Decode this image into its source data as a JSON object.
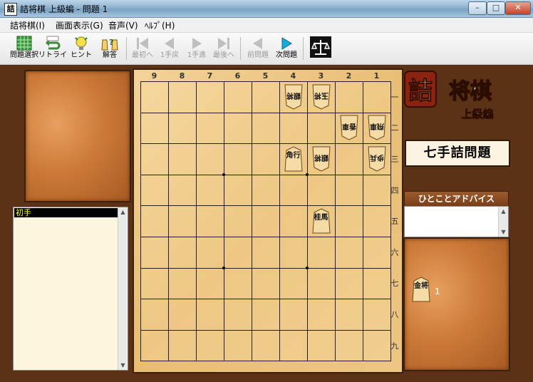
{
  "window": {
    "app_icon": "詰",
    "title": "詰将棋 上級編 - 問題 1",
    "buttons": {
      "minimize": "–",
      "maximize": "□",
      "close": "✕"
    }
  },
  "menu": [
    {
      "label": "詰将棋(I)"
    },
    {
      "label": "画面表示(G)"
    },
    {
      "label": "音声(V)"
    },
    {
      "label": "ﾍﾙﾌﾟ(H)"
    }
  ],
  "toolbar": [
    {
      "label": "問題選択",
      "icon": "grid-icon",
      "enabled": true
    },
    {
      "label": "リトライ",
      "icon": "retry-icon",
      "enabled": true
    },
    {
      "label": "ヒント",
      "icon": "hint-icon",
      "enabled": true
    },
    {
      "label": "解答",
      "icon": "answer-icon",
      "enabled": true
    },
    {
      "label": "最初へ",
      "icon": "first-icon",
      "enabled": false
    },
    {
      "label": "1手戻",
      "icon": "back-icon",
      "enabled": false
    },
    {
      "label": "1手進",
      "icon": "forward-icon",
      "enabled": false
    },
    {
      "label": "最後へ",
      "icon": "last-icon",
      "enabled": false
    },
    {
      "label": "前問題",
      "icon": "prev-problem-icon",
      "enabled": false
    },
    {
      "label": "次問題",
      "icon": "next-problem-icon",
      "enabled": true
    },
    {
      "label": "",
      "icon": "balance-icon",
      "enabled": true
    }
  ],
  "move_log": {
    "items": [
      "初手"
    ],
    "selected": 0
  },
  "board": {
    "col_labels": [
      "9",
      "8",
      "7",
      "6",
      "5",
      "4",
      "3",
      "2",
      "1"
    ],
    "row_labels": [
      "一",
      "二",
      "三",
      "四",
      "五",
      "六",
      "七",
      "八",
      "九"
    ],
    "pieces": [
      {
        "file": 4,
        "rank": 1,
        "text": "銀将",
        "owner": "gote"
      },
      {
        "file": 3,
        "rank": 1,
        "text": "玉将",
        "owner": "gote"
      },
      {
        "file": 2,
        "rank": 2,
        "text": "香車",
        "owner": "gote"
      },
      {
        "file": 1,
        "rank": 2,
        "text": "飛車",
        "owner": "gote"
      },
      {
        "file": 4,
        "rank": 3,
        "text": "角行",
        "owner": "sente"
      },
      {
        "file": 3,
        "rank": 3,
        "text": "銀将",
        "owner": "gote"
      },
      {
        "file": 1,
        "rank": 3,
        "text": "歩兵",
        "owner": "gote"
      },
      {
        "file": 3,
        "rank": 5,
        "text": "桂馬",
        "owner": "sente"
      }
    ]
  },
  "logo": {
    "main": "詰将棋",
    "sub": "上級編"
  },
  "problem_label": "七手詰問題",
  "advice": {
    "header": "ひとことアドバイス",
    "text": ""
  },
  "hand": {
    "piece": "金将",
    "count": "1"
  }
}
